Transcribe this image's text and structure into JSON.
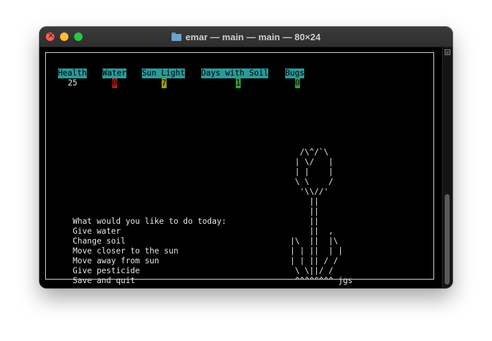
{
  "window": {
    "title": "emar — main — main — 80×24",
    "folder_icon": "folder-icon"
  },
  "stats": {
    "headers": [
      "Health",
      "Water",
      "Sun Light",
      "Days with Soil",
      "Bugs"
    ],
    "values": [
      "25",
      "0",
      "7",
      "1",
      "0"
    ],
    "colors": {
      "header_bg": "#2a9a9a",
      "water": "#b01a1a",
      "sun": "#9b9b1a",
      "soil": "#2aa02a",
      "bugs": "#2aa02a"
    }
  },
  "menu": {
    "prompt": "What would you like to do today:",
    "items": [
      "Give water",
      "Change soil",
      "Move closer to the sun",
      "Move away from sun",
      "Give pesticide",
      "Save and quit"
    ]
  },
  "art": {
    "lines": [
      "  /\\^/`\\",
      " | \\/   |",
      " | |    |",
      " \\ \\    /",
      "  '\\\\//'",
      "    ||",
      "    ||",
      "    ||",
      "    ||  ,",
      "|\\  ||  |\\",
      "| | ||  | |",
      "| | || / /",
      " \\ \\||/ /",
      " ^^^^^^^^ jgs"
    ]
  }
}
